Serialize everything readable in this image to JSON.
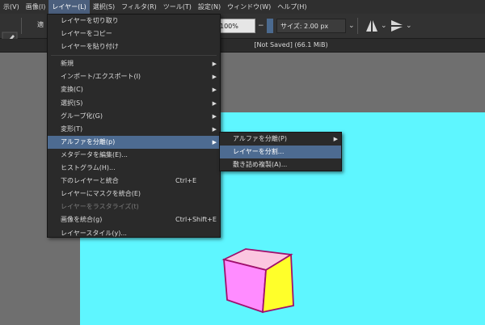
{
  "menubar": {
    "items": [
      {
        "label": "示(V)"
      },
      {
        "label": "画像(I)"
      },
      {
        "label": "レイヤー(L)",
        "active": true
      },
      {
        "label": "選択(S)"
      },
      {
        "label": "フィルタ(R)"
      },
      {
        "label": "ツール(T)"
      },
      {
        "label": "設定(N)"
      },
      {
        "label": "ウィンドウ(W)"
      },
      {
        "label": "ヘルプ(H)"
      }
    ]
  },
  "toolbar": {
    "zoom_value": "100%",
    "size_value": "サイズ:  2.00 px",
    "partial_label": "適"
  },
  "status": {
    "title": "[Not Saved]  (66.1 MiB)"
  },
  "layer_menu": {
    "items": [
      {
        "label": "レイヤーを切り取り"
      },
      {
        "label": "レイヤーをコピー"
      },
      {
        "label": "レイヤーを貼り付け"
      },
      {
        "separator": true
      },
      {
        "label": "新規",
        "submenu": true
      },
      {
        "label": "インポート/エクスポート(I)",
        "submenu": true
      },
      {
        "label": "変換(C)",
        "submenu": true
      },
      {
        "label": "選択(S)",
        "submenu": true
      },
      {
        "label": "グループ化(G)",
        "submenu": true
      },
      {
        "label": "変形(T)",
        "submenu": true
      },
      {
        "label": "アルファを分離(p)",
        "submenu": true,
        "selected": true
      },
      {
        "label": "メタデータを編集(E)..."
      },
      {
        "label": "ヒストグラム(H)..."
      },
      {
        "label": "下のレイヤーと統合",
        "shortcut": "Ctrl+E"
      },
      {
        "label": "レイヤーにマスクを統合(E)"
      },
      {
        "label": "レイヤーをラスタライズ(t)",
        "disabled": true
      },
      {
        "label": "画像を統合(g)",
        "shortcut": "Ctrl+Shift+E"
      },
      {
        "label": "レイヤースタイル(y)..."
      }
    ]
  },
  "alpha_submenu": {
    "items": [
      {
        "label": "アルファを分離(P)",
        "submenu": true
      },
      {
        "label": "レイヤーを分割...",
        "selected": true
      },
      {
        "label": "敷き詰め複製(A)..."
      }
    ]
  },
  "colors": {
    "canvas": "#5ef6ff",
    "cube_top": "#fbc6e0",
    "cube_left": "#ff8cff",
    "cube_right": "#ffff2a",
    "cube_outline": "#a0106e",
    "menu_highlight": "#4d6b91"
  },
  "icons": {
    "brush_icon": "brush-icon",
    "mirror_h_icon": "mirror-horizontal-icon",
    "mirror_v_icon": "mirror-vertical-icon"
  }
}
